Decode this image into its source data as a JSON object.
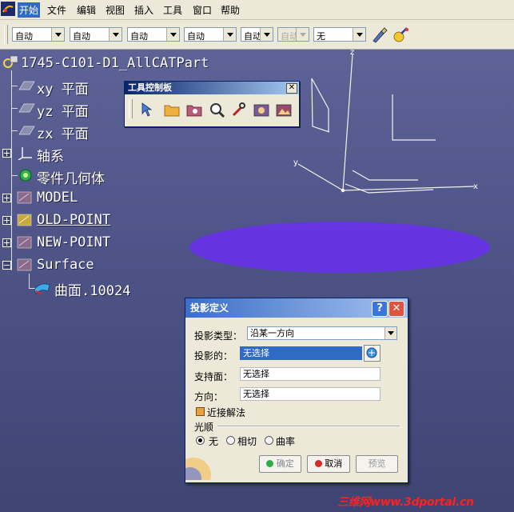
{
  "menu": [
    "开始",
    "文件",
    "编辑",
    "视图",
    "插入",
    "工具",
    "窗口",
    "帮助"
  ],
  "toolbar": {
    "combos": [
      "自动",
      "自动",
      "自动",
      "自动",
      "自动",
      "自动",
      "无"
    ]
  },
  "tree": {
    "root": "1745-C101-D1_AllCATPart",
    "items": [
      "xy 平面",
      "yz 平面",
      "zx 平面",
      "轴系",
      "零件几何体",
      "MODEL",
      "OLD-POINT",
      "NEW-POINT",
      "Surface"
    ],
    "child": "曲面.10024"
  },
  "axes": {
    "x": "x",
    "y": "y",
    "z": "z"
  },
  "palette": {
    "title": "工具控制板"
  },
  "dialog": {
    "title": "投影定义",
    "help": "?",
    "close": "✕",
    "type_label": "投影类型：",
    "type_value": "沿某一方向",
    "projected_label": "投影的：",
    "projected_value": "无选择",
    "support_label": "支持面：",
    "support_value": "无选择",
    "direction_label": "方向：",
    "direction_value": "无选择",
    "nearest_label": "近接解法",
    "smoothing_label": "光顺",
    "radio_none": "无",
    "radio_tangent": "相切",
    "radio_curvature": "曲率",
    "ok": "确定",
    "cancel": "取消",
    "preview": "预览"
  },
  "watermark": "三维网www.3dportal.cn",
  "colors": {
    "background": "#4f5588",
    "surface": "#6a2ef0",
    "title_bar": "#3a6ec8"
  }
}
